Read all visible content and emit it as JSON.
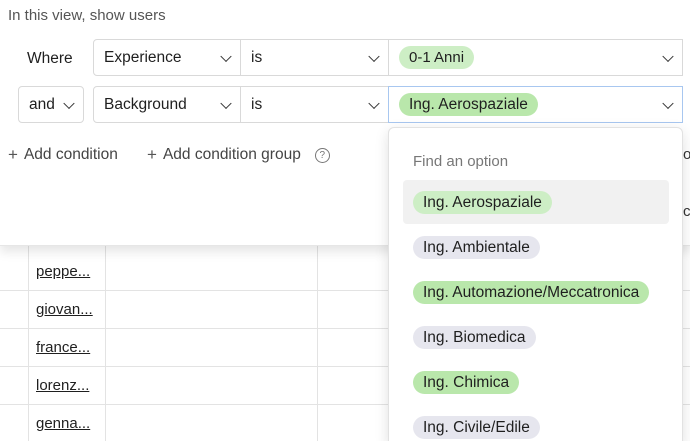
{
  "filter": {
    "title": "In this view, show users",
    "where_label": "Where",
    "rows": [
      {
        "conjunction": "",
        "field": "Experience",
        "operator": "is",
        "value": "0-1 Anni"
      },
      {
        "conjunction": "and",
        "field": "Background",
        "operator": "is",
        "value": "Ing. Aerospaziale"
      }
    ],
    "add_condition": "Add condition",
    "add_condition_group": "Add condition group"
  },
  "dropdown": {
    "search_placeholder": "Find an option",
    "options": [
      {
        "label": "Ing. Aerospaziale",
        "color": "#cdeec5",
        "highlighted": true
      },
      {
        "label": "Ing. Ambientale",
        "color": "#e6e6ee",
        "highlighted": false
      },
      {
        "label": "Ing. Automazione/Meccatronica",
        "color": "#b9e7ab",
        "highlighted": false
      },
      {
        "label": "Ing. Biomedica",
        "color": "#e6e6ee",
        "highlighted": false
      },
      {
        "label": "Ing. Chimica",
        "color": "#b9e7ab",
        "highlighted": false
      },
      {
        "label": "Ing. Civile/Edile",
        "color": "#e6e6ee",
        "highlighted": false
      }
    ]
  },
  "table": {
    "rows": [
      "peppe...",
      "giovan...",
      "france...",
      "lorenz...",
      "genna..."
    ]
  }
}
